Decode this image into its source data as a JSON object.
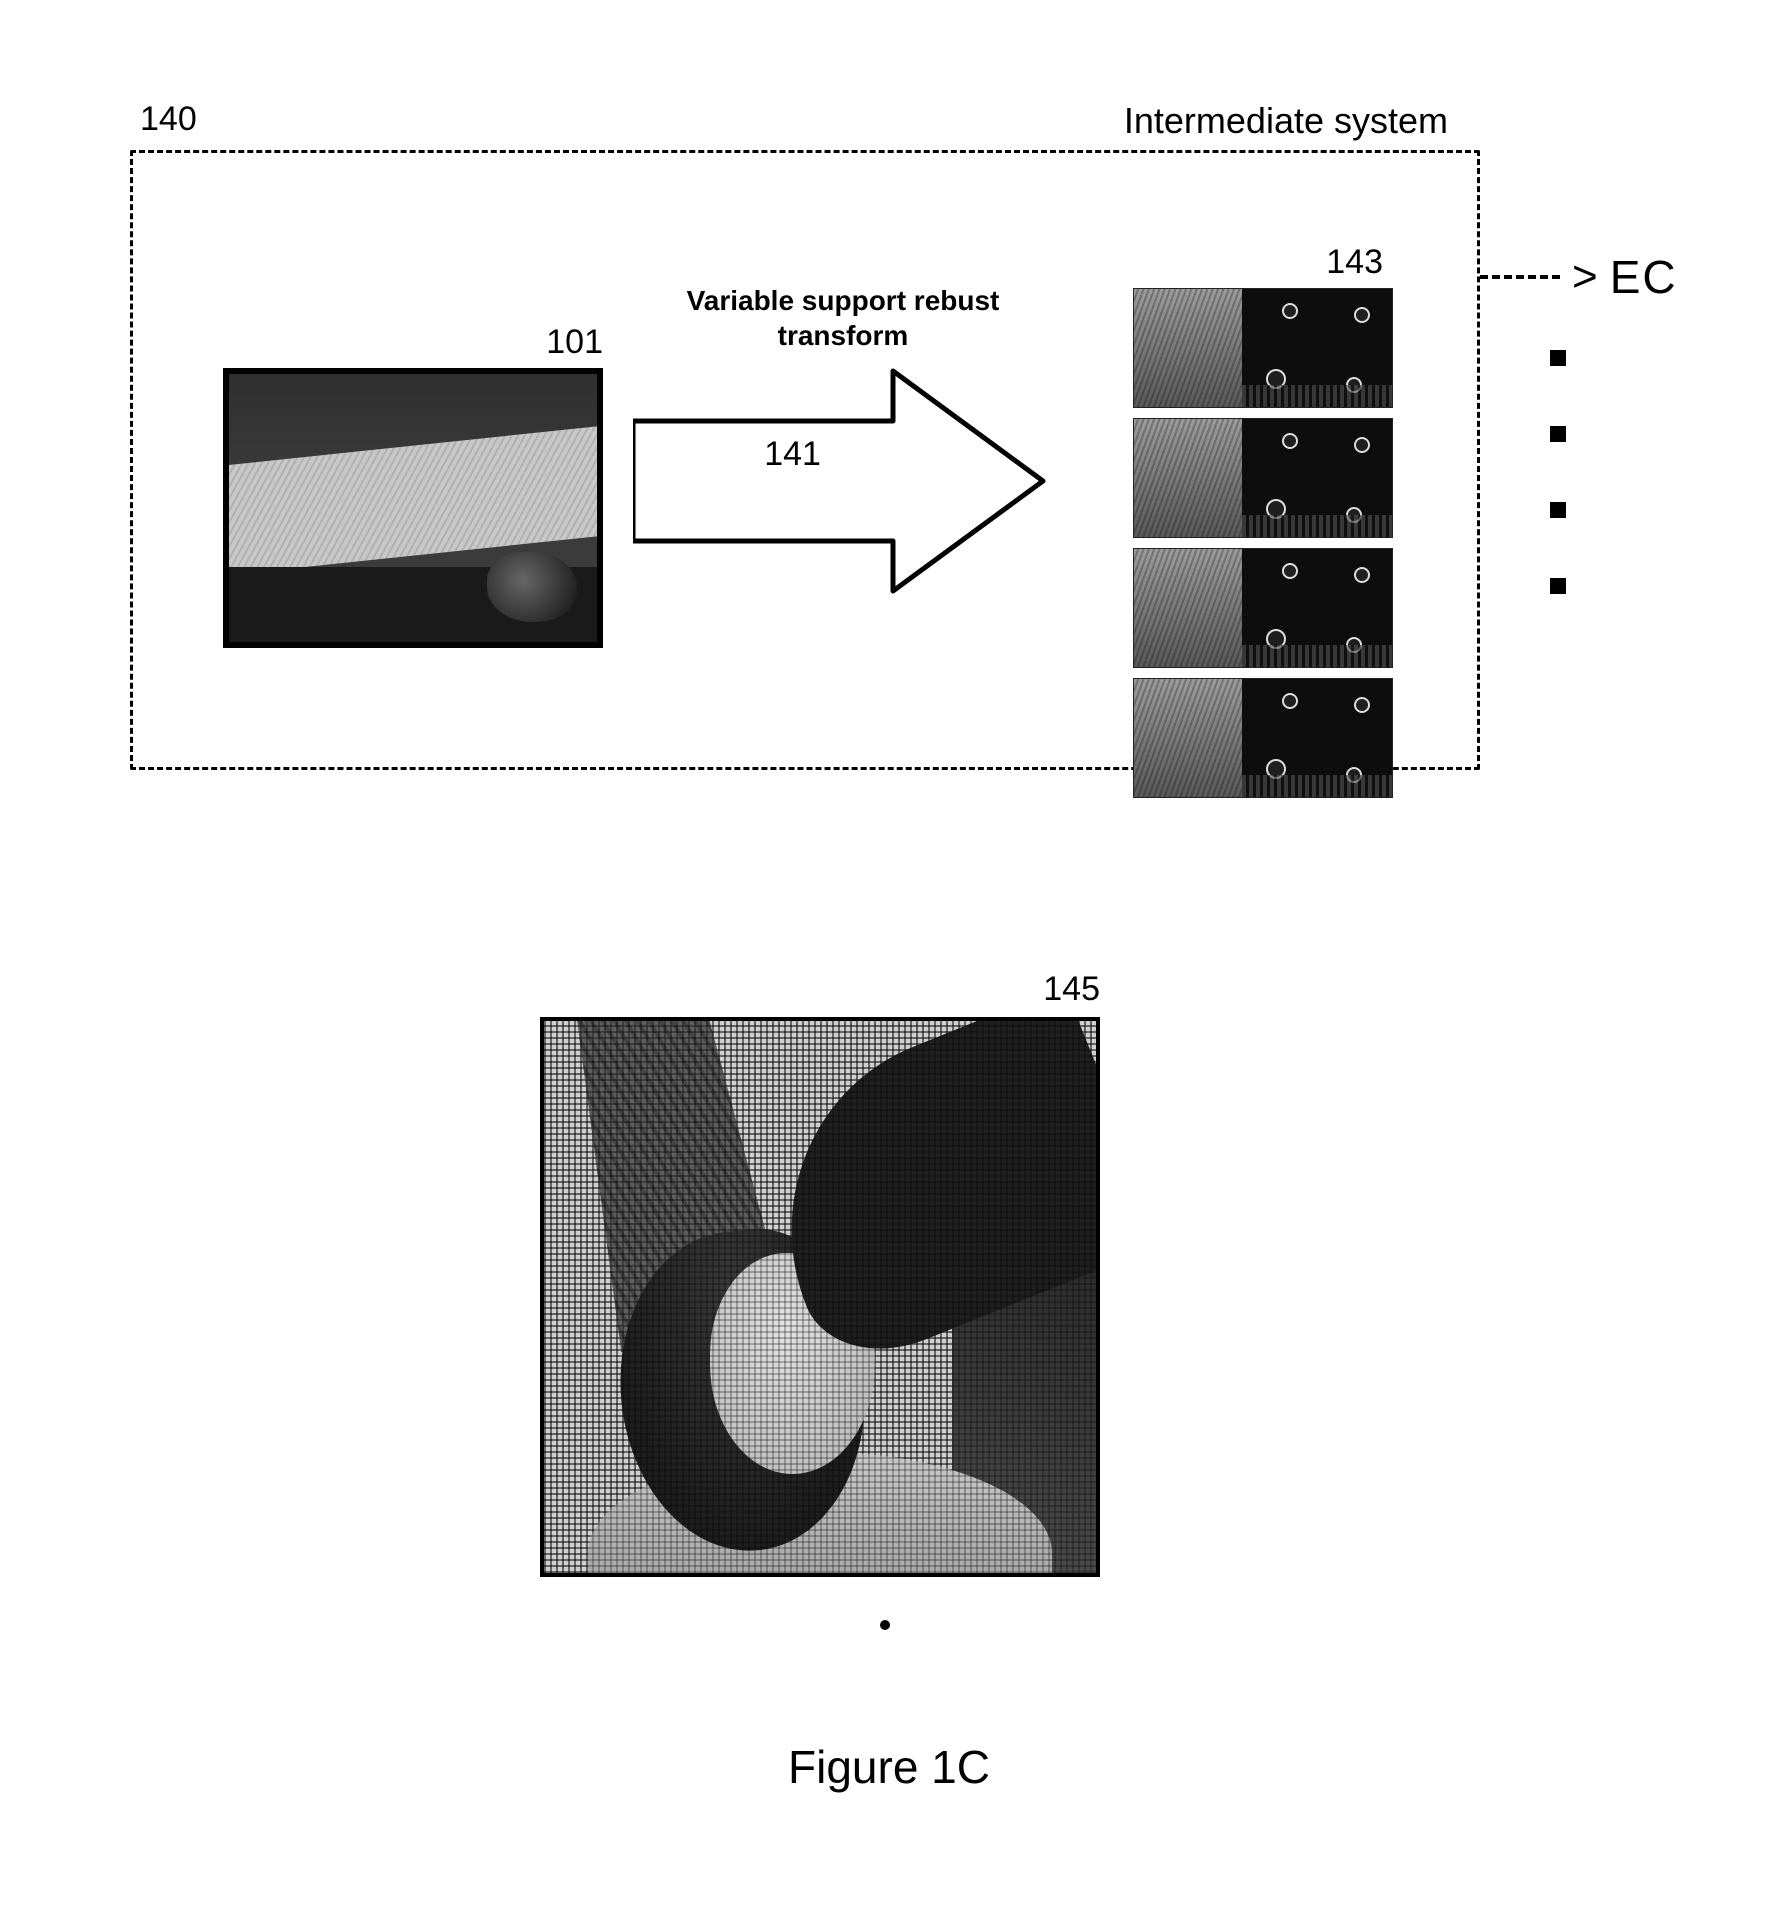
{
  "system": {
    "number_label": "140",
    "title_label": "Intermediate system"
  },
  "input": {
    "label": "101"
  },
  "arrow": {
    "title_line1": "Variable support rebust",
    "title_line2": "transform",
    "label": "141"
  },
  "thumbnails": {
    "label": "143"
  },
  "ec": {
    "symbol": ">",
    "text": "EC"
  },
  "output": {
    "label": "145"
  },
  "caption": "Figure 1C"
}
